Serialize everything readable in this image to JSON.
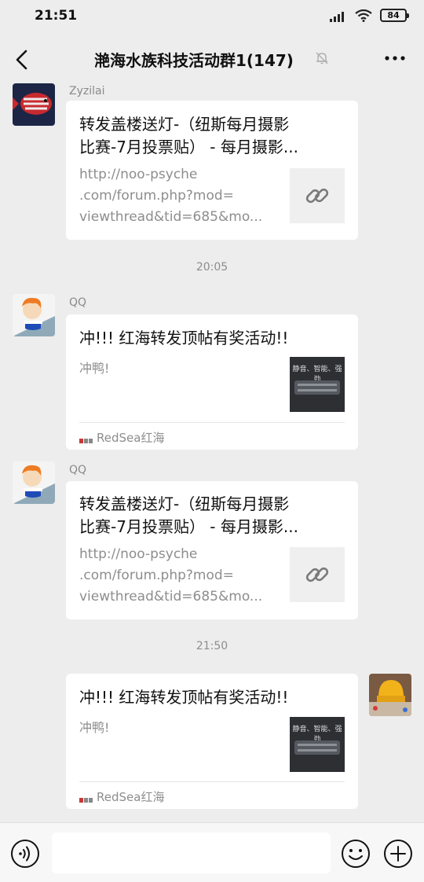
{
  "status_bar": {
    "time": "21:51",
    "battery": "84",
    "signal_icon": "signal-icon",
    "wifi_icon": "wifi-icon"
  },
  "nav": {
    "title": "滟海水族科技活动群1(147)",
    "back_icon": "back-icon",
    "mute_icon": "mute-bell-icon",
    "more_icon": "more-icon"
  },
  "messages": [
    {
      "sender": "Zyzilai",
      "title_line1": "转发盖楼送灯-（纽斯每月摄影",
      "title_line2": "比赛-7月投票贴） - 每月摄影...",
      "url_line1": "http://noo-psyche",
      "url_line2": ".com/forum.php?mod=",
      "url_line3": "viewthread&tid=685&mo..."
    },
    {
      "sender": "QQ",
      "title": "冲!!! 红海转发顶帖有奖活动!!",
      "desc": "冲鸭!",
      "thumb_text": "静音、智能、强劲",
      "source": "RedSea红海"
    },
    {
      "sender": "QQ",
      "title_line1": "转发盖楼送灯-（纽斯每月摄影",
      "title_line2": "比赛-7月投票贴） - 每月摄影...",
      "url_line1": "http://noo-psyche",
      "url_line2": ".com/forum.php?mod=",
      "url_line3": "viewthread&tid=685&mo..."
    },
    {
      "title": "冲!!! 红海转发顶帖有奖活动!!",
      "desc": "冲鸭!",
      "thumb_text": "静音、智能、强劲",
      "source": "RedSea红海"
    }
  ],
  "timestamps": [
    "20:05",
    "21:50"
  ],
  "bottom_bar": {
    "voice_icon": "voice-icon",
    "emoji_icon": "emoji-icon",
    "plus_icon": "plus-icon"
  },
  "colors": {
    "background": "#ededed",
    "card": "#ffffff",
    "muted_text": "#8d8d8d"
  }
}
